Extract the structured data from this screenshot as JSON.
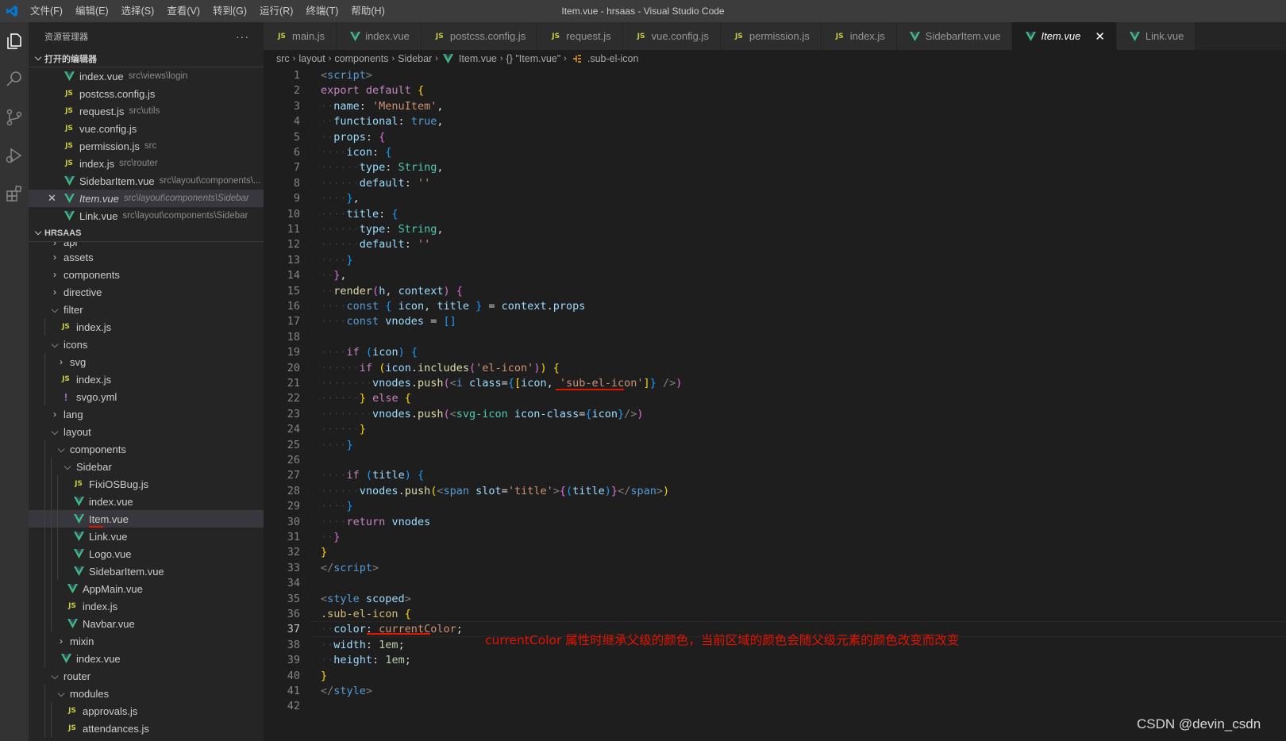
{
  "window": {
    "title": "Item.vue - hrsaas - Visual Studio Code"
  },
  "menu": [
    "文件(F)",
    "编辑(E)",
    "选择(S)",
    "查看(V)",
    "转到(G)",
    "运行(R)",
    "终端(T)",
    "帮助(H)"
  ],
  "activity_icons": [
    "files-icon",
    "search-icon",
    "source-control-icon",
    "run-debug-icon",
    "extensions-icon"
  ],
  "sidebar": {
    "title": "资源管理器",
    "more": "···",
    "open_editors": {
      "label": "打开的编辑器",
      "items": [
        {
          "icon": "vue",
          "name": "index.vue",
          "path": "src\\views\\login"
        },
        {
          "icon": "js",
          "name": "postcss.config.js",
          "path": ""
        },
        {
          "icon": "js",
          "name": "request.js",
          "path": "src\\utils"
        },
        {
          "icon": "js",
          "name": "vue.config.js",
          "path": ""
        },
        {
          "icon": "js",
          "name": "permission.js",
          "path": "src"
        },
        {
          "icon": "js",
          "name": "index.js",
          "path": "src\\router"
        },
        {
          "icon": "vue",
          "name": "SidebarItem.vue",
          "path": "src\\layout\\components\\..."
        },
        {
          "icon": "vue",
          "name": "Item.vue",
          "path": "src\\layout\\components\\Sidebar",
          "active": true
        },
        {
          "icon": "vue",
          "name": "Link.vue",
          "path": "src\\layout\\components\\Sidebar"
        }
      ]
    },
    "project": {
      "label": "HRSAAS",
      "tree": [
        {
          "type": "folder",
          "name": "api",
          "depth": 1,
          "open": false,
          "cut": true
        },
        {
          "type": "folder",
          "name": "assets",
          "depth": 1,
          "open": false
        },
        {
          "type": "folder",
          "name": "components",
          "depth": 1,
          "open": false
        },
        {
          "type": "folder",
          "name": "directive",
          "depth": 1,
          "open": false
        },
        {
          "type": "folder",
          "name": "filter",
          "depth": 1,
          "open": true
        },
        {
          "type": "js",
          "name": "index.js",
          "depth": 2
        },
        {
          "type": "folder",
          "name": "icons",
          "depth": 1,
          "open": true
        },
        {
          "type": "folder",
          "name": "svg",
          "depth": 2,
          "open": false
        },
        {
          "type": "js",
          "name": "index.js",
          "depth": 2
        },
        {
          "type": "yml",
          "name": "svgo.yml",
          "depth": 2
        },
        {
          "type": "folder",
          "name": "lang",
          "depth": 1,
          "open": false
        },
        {
          "type": "folder",
          "name": "layout",
          "depth": 1,
          "open": true
        },
        {
          "type": "folder",
          "name": "components",
          "depth": 2,
          "open": true
        },
        {
          "type": "folder",
          "name": "Sidebar",
          "depth": 3,
          "open": true
        },
        {
          "type": "js",
          "name": "FixiOSBug.js",
          "depth": 4
        },
        {
          "type": "vue",
          "name": "index.vue",
          "depth": 4
        },
        {
          "type": "vue",
          "name": "Item.vue",
          "depth": 4,
          "selected": true
        },
        {
          "type": "vue",
          "name": "Link.vue",
          "depth": 4
        },
        {
          "type": "vue",
          "name": "Logo.vue",
          "depth": 4
        },
        {
          "type": "vue",
          "name": "SidebarItem.vue",
          "depth": 4
        },
        {
          "type": "vue",
          "name": "AppMain.vue",
          "depth": 3
        },
        {
          "type": "js",
          "name": "index.js",
          "depth": 3
        },
        {
          "type": "vue",
          "name": "Navbar.vue",
          "depth": 3
        },
        {
          "type": "folder",
          "name": "mixin",
          "depth": 2,
          "open": false
        },
        {
          "type": "vue",
          "name": "index.vue",
          "depth": 2
        },
        {
          "type": "folder",
          "name": "router",
          "depth": 1,
          "open": true
        },
        {
          "type": "folder",
          "name": "modules",
          "depth": 2,
          "open": true
        },
        {
          "type": "js",
          "name": "approvals.js",
          "depth": 3
        },
        {
          "type": "js",
          "name": "attendances.js",
          "depth": 3
        }
      ]
    }
  },
  "tabs": [
    {
      "icon": "js",
      "name": "main.js"
    },
    {
      "icon": "vue",
      "name": "index.vue"
    },
    {
      "icon": "js",
      "name": "postcss.config.js"
    },
    {
      "icon": "js",
      "name": "request.js"
    },
    {
      "icon": "js",
      "name": "vue.config.js"
    },
    {
      "icon": "js",
      "name": "permission.js"
    },
    {
      "icon": "js",
      "name": "index.js"
    },
    {
      "icon": "vue",
      "name": "SidebarItem.vue"
    },
    {
      "icon": "vue",
      "name": "Item.vue",
      "active": true,
      "close": "✕"
    },
    {
      "icon": "vue",
      "name": "Link.vue"
    }
  ],
  "breadcrumb": [
    "src",
    "layout",
    "components",
    "Sidebar",
    "Item.vue",
    "{} \"Item.vue\"",
    ".sub-el-icon"
  ],
  "editor": {
    "current_line": 37,
    "lines": [
      [
        [
          "t",
          "<"
        ],
        [
          "tn",
          "script"
        ],
        [
          "t",
          ">"
        ]
      ],
      [
        [
          "kw",
          "export"
        ],
        [
          "p",
          " "
        ],
        [
          "kw",
          "default"
        ],
        [
          "p",
          " "
        ],
        [
          "br",
          "{"
        ]
      ],
      [
        [
          "ws",
          "··"
        ],
        [
          "prop",
          "name"
        ],
        [
          "p",
          ": "
        ],
        [
          "str",
          "'MenuItem'"
        ],
        [
          "p",
          ","
        ]
      ],
      [
        [
          "ws",
          "··"
        ],
        [
          "prop",
          "functional"
        ],
        [
          "p",
          ": "
        ],
        [
          "kw2",
          "true"
        ],
        [
          "p",
          ","
        ]
      ],
      [
        [
          "ws",
          "··"
        ],
        [
          "prop",
          "props"
        ],
        [
          "p",
          ": "
        ],
        [
          "br2",
          "{"
        ]
      ],
      [
        [
          "ws",
          "····"
        ],
        [
          "prop",
          "icon"
        ],
        [
          "p",
          ": "
        ],
        [
          "br3",
          "{"
        ]
      ],
      [
        [
          "ws",
          "······"
        ],
        [
          "prop",
          "type"
        ],
        [
          "p",
          ": "
        ],
        [
          "type",
          "String"
        ],
        [
          "p",
          ","
        ]
      ],
      [
        [
          "ws",
          "······"
        ],
        [
          "prop",
          "default"
        ],
        [
          "p",
          ": "
        ],
        [
          "str",
          "''"
        ]
      ],
      [
        [
          "ws",
          "····"
        ],
        [
          "br3",
          "}"
        ],
        [
          "p",
          ","
        ]
      ],
      [
        [
          "ws",
          "····"
        ],
        [
          "prop",
          "title"
        ],
        [
          "p",
          ": "
        ],
        [
          "br3",
          "{"
        ]
      ],
      [
        [
          "ws",
          "······"
        ],
        [
          "prop",
          "type"
        ],
        [
          "p",
          ": "
        ],
        [
          "type",
          "String"
        ],
        [
          "p",
          ","
        ]
      ],
      [
        [
          "ws",
          "······"
        ],
        [
          "prop",
          "default"
        ],
        [
          "p",
          ": "
        ],
        [
          "str",
          "''"
        ]
      ],
      [
        [
          "ws",
          "····"
        ],
        [
          "br3",
          "}"
        ]
      ],
      [
        [
          "ws",
          "··"
        ],
        [
          "br2",
          "}"
        ],
        [
          "p",
          ","
        ]
      ],
      [
        [
          "ws",
          "··"
        ],
        [
          "fn",
          "render"
        ],
        [
          "br2",
          "("
        ],
        [
          "prop",
          "h"
        ],
        [
          "p",
          ", "
        ],
        [
          "prop",
          "context"
        ],
        [
          "br2",
          ")"
        ],
        [
          "p",
          " "
        ],
        [
          "br2",
          "{"
        ]
      ],
      [
        [
          "ws",
          "····"
        ],
        [
          "kw2",
          "const"
        ],
        [
          "p",
          " "
        ],
        [
          "br3",
          "{"
        ],
        [
          "p",
          " "
        ],
        [
          "prop",
          "icon"
        ],
        [
          "p",
          ", "
        ],
        [
          "prop",
          "title"
        ],
        [
          "p",
          " "
        ],
        [
          "br3",
          "}"
        ],
        [
          "p",
          " = "
        ],
        [
          "prop",
          "context"
        ],
        [
          "p",
          "."
        ],
        [
          "prop",
          "props"
        ]
      ],
      [
        [
          "ws",
          "····"
        ],
        [
          "kw2",
          "const"
        ],
        [
          "p",
          " "
        ],
        [
          "prop",
          "vnodes"
        ],
        [
          "p",
          " = "
        ],
        [
          "br3",
          "[]"
        ]
      ],
      [],
      [
        [
          "ws",
          "····"
        ],
        [
          "kw",
          "if"
        ],
        [
          "p",
          " "
        ],
        [
          "br3",
          "("
        ],
        [
          "prop",
          "icon"
        ],
        [
          "br3",
          ")"
        ],
        [
          "p",
          " "
        ],
        [
          "br3",
          "{"
        ]
      ],
      [
        [
          "ws",
          "······"
        ],
        [
          "kw",
          "if"
        ],
        [
          "p",
          " "
        ],
        [
          "br",
          "("
        ],
        [
          "prop",
          "icon"
        ],
        [
          "p",
          "."
        ],
        [
          "fn",
          "includes"
        ],
        [
          "br2",
          "("
        ],
        [
          "str",
          "'el-icon'"
        ],
        [
          "br2",
          ")"
        ],
        [
          "br",
          ")"
        ],
        [
          "p",
          " "
        ],
        [
          "br",
          "{"
        ]
      ],
      [
        [
          "ws",
          "········"
        ],
        [
          "prop",
          "vnodes"
        ],
        [
          "p",
          "."
        ],
        [
          "fn",
          "push"
        ],
        [
          "br2",
          "("
        ],
        [
          "t",
          "<"
        ],
        [
          "tn",
          "i"
        ],
        [
          "p",
          " "
        ],
        [
          "prop",
          "class"
        ],
        [
          "p",
          "="
        ],
        [
          "br3",
          "{"
        ],
        [
          "br",
          "["
        ],
        [
          "prop",
          "icon"
        ],
        [
          "p",
          ", "
        ],
        [
          "str",
          "'sub-el-icon'"
        ],
        [
          "br",
          "]"
        ],
        [
          "br3",
          "}"
        ],
        [
          "p",
          " "
        ],
        [
          "t",
          "/>"
        ],
        [
          "br2",
          ")"
        ]
      ],
      [
        [
          "ws",
          "······"
        ],
        [
          "br",
          "}"
        ],
        [
          "p",
          " "
        ],
        [
          "kw",
          "else"
        ],
        [
          "p",
          " "
        ],
        [
          "br",
          "{"
        ]
      ],
      [
        [
          "ws",
          "········"
        ],
        [
          "prop",
          "vnodes"
        ],
        [
          "p",
          "."
        ],
        [
          "fn",
          "push"
        ],
        [
          "br2",
          "("
        ],
        [
          "t",
          "<"
        ],
        [
          "type",
          "svg-icon"
        ],
        [
          "p",
          " "
        ],
        [
          "prop",
          "icon-class"
        ],
        [
          "p",
          "="
        ],
        [
          "br3",
          "{"
        ],
        [
          "prop",
          "icon"
        ],
        [
          "br3",
          "}"
        ],
        [
          "t",
          "/>"
        ],
        [
          "br2",
          ")"
        ]
      ],
      [
        [
          "ws",
          "······"
        ],
        [
          "br",
          "}"
        ]
      ],
      [
        [
          "ws",
          "····"
        ],
        [
          "br3",
          "}"
        ]
      ],
      [],
      [
        [
          "ws",
          "····"
        ],
        [
          "kw",
          "if"
        ],
        [
          "p",
          " "
        ],
        [
          "br3",
          "("
        ],
        [
          "prop",
          "title"
        ],
        [
          "br3",
          ")"
        ],
        [
          "p",
          " "
        ],
        [
          "br3",
          "{"
        ]
      ],
      [
        [
          "ws",
          "······"
        ],
        [
          "prop",
          "vnodes"
        ],
        [
          "p",
          "."
        ],
        [
          "fn",
          "push"
        ],
        [
          "br",
          "("
        ],
        [
          "t",
          "<"
        ],
        [
          "tn",
          "span"
        ],
        [
          "p",
          " "
        ],
        [
          "prop",
          "slot"
        ],
        [
          "p",
          "="
        ],
        [
          "str",
          "'title'"
        ],
        [
          "t",
          ">"
        ],
        [
          "br2",
          "{"
        ],
        [
          "br3",
          "("
        ],
        [
          "prop",
          "title"
        ],
        [
          "br3",
          ")"
        ],
        [
          "br2",
          "}"
        ],
        [
          "t",
          "</"
        ],
        [
          "tn",
          "span"
        ],
        [
          "t",
          ">"
        ],
        [
          "br",
          ")"
        ]
      ],
      [
        [
          "ws",
          "····"
        ],
        [
          "br3",
          "}"
        ]
      ],
      [
        [
          "ws",
          "····"
        ],
        [
          "kw",
          "return"
        ],
        [
          "p",
          " "
        ],
        [
          "prop",
          "vnodes"
        ]
      ],
      [
        [
          "ws",
          "··"
        ],
        [
          "br2",
          "}"
        ]
      ],
      [
        [
          "br",
          "}"
        ]
      ],
      [
        [
          "t",
          "</"
        ],
        [
          "tn",
          "script"
        ],
        [
          "t",
          ">"
        ]
      ],
      [],
      [
        [
          "t",
          "<"
        ],
        [
          "tn",
          "style"
        ],
        [
          "p",
          " "
        ],
        [
          "prop",
          "scoped"
        ],
        [
          "t",
          ">"
        ]
      ],
      [
        [
          "sel",
          ".sub-el-icon"
        ],
        [
          "p",
          " "
        ],
        [
          "br",
          "{"
        ]
      ],
      [
        [
          "ws",
          "··"
        ],
        [
          "prop",
          "color"
        ],
        [
          "p",
          ": "
        ],
        [
          "str",
          "currentColor"
        ],
        [
          "p",
          ";"
        ]
      ],
      [
        [
          "ws",
          "··"
        ],
        [
          "prop",
          "width"
        ],
        [
          "p",
          ": "
        ],
        [
          "num",
          "1em"
        ],
        [
          "p",
          ";"
        ]
      ],
      [
        [
          "ws",
          "··"
        ],
        [
          "prop",
          "height"
        ],
        [
          "p",
          ": "
        ],
        [
          "num",
          "1em"
        ],
        [
          "p",
          ";"
        ]
      ],
      [
        [
          "br",
          "}"
        ]
      ],
      [
        [
          "t",
          "</"
        ],
        [
          "tn",
          "style"
        ],
        [
          "t",
          ">"
        ]
      ],
      []
    ]
  },
  "annotation": "currentColor 属性时继承父级的颜色，当前区域的颜色会随父级元素的颜色改变而改变",
  "watermark": "CSDN @devin_csdn",
  "colors": {
    "vue_icon": "#41b883",
    "js_icon": "#cbcb41",
    "annotation_red": "#e51400",
    "vscode_blue": "#0078d4"
  }
}
